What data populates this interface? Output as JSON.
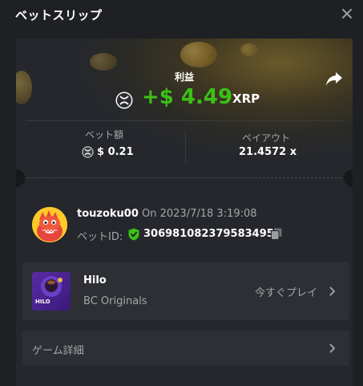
{
  "header": {
    "title": "ベットスリップ"
  },
  "result": {
    "label": "利益",
    "amount": "+$ 4.49",
    "currency": "XRP"
  },
  "bet": {
    "amount_label": "ベット額",
    "amount_value": "$ 0.21",
    "payout_label": "ペイアウト",
    "payout_value": "21.4572 x"
  },
  "player": {
    "username": "touzoku00",
    "date_text": "On 2023/7/18 3:19:08",
    "bet_id_label": "ベットID:",
    "bet_id": "306981082379583495"
  },
  "game": {
    "name": "Hilo",
    "provider": "BC Originals",
    "thumb_text": "HILO",
    "play_label": "今すぐプレイ"
  },
  "details": {
    "label": "ゲーム詳細"
  },
  "colors": {
    "profit": "#3bc117",
    "background": "#1e2024",
    "card": "#25272c",
    "row": "#2d2f34",
    "muted": "#a4a6aa"
  },
  "icons": [
    "close-icon",
    "share-icon",
    "xrp-coin-icon",
    "shield-check-icon",
    "copy-icon",
    "chevron-right-icon"
  ]
}
